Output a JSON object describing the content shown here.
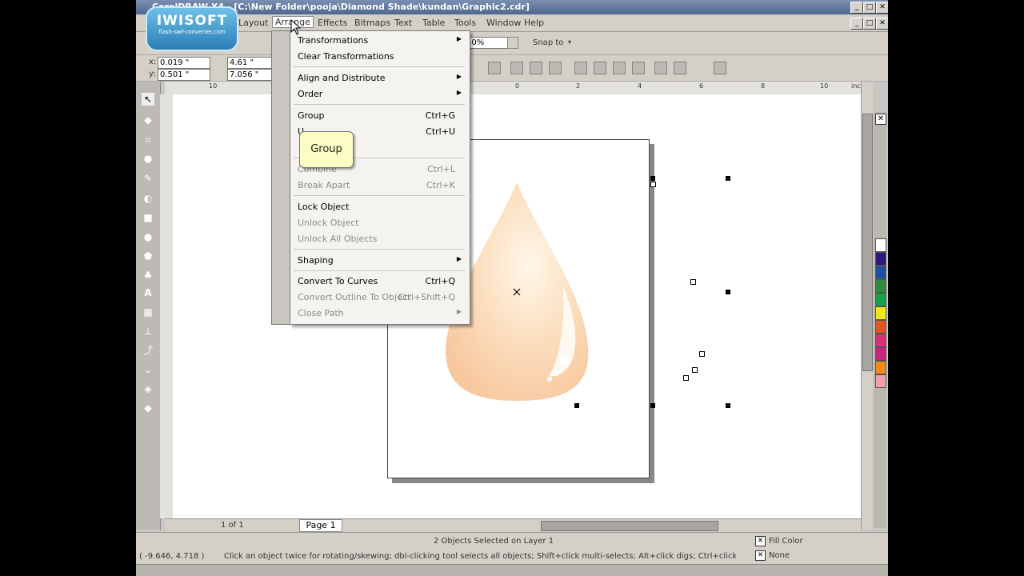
{
  "window": {
    "title": "CorelDRAW X4 - [C:\\New Folder\\pooja\\Diamond Shade\\kundan\\Graphic2.cdr]",
    "controls": [
      "_",
      "□",
      "✕"
    ]
  },
  "logo": {
    "brand": "IWISOFT",
    "tagline": "flash-swf-converter.com"
  },
  "menubar": {
    "items": [
      "Layout",
      "Arrange",
      "Effects",
      "Bitmaps",
      "Text",
      "Table",
      "Tools",
      "Window",
      "Help"
    ]
  },
  "stdbar": {
    "zoom": "40%",
    "snap_to": "Snap to"
  },
  "propbar": {
    "x": "0.019 \"",
    "y": "0.501 \"",
    "w": "4.61 \"",
    "h": "7.056 \""
  },
  "ruler": {
    "unit": "inches",
    "ticks": [
      "10",
      "0",
      "2",
      "4",
      "6",
      "8",
      "10"
    ]
  },
  "arrange_menu": {
    "items": [
      {
        "label": "Transformations",
        "shortcut": "",
        "submenu": true,
        "enabled": true
      },
      {
        "label": "Clear Transformations",
        "shortcut": "",
        "submenu": false,
        "enabled": true
      },
      {
        "label": "Align and Distribute",
        "shortcut": "",
        "submenu": true,
        "enabled": true
      },
      {
        "label": "Order",
        "shortcut": "",
        "submenu": true,
        "enabled": true
      },
      {
        "label": "Group",
        "shortcut": "Ctrl+G",
        "submenu": false,
        "enabled": true
      },
      {
        "label": "U",
        "shortcut": "Ctrl+U",
        "submenu": false,
        "enabled": true
      },
      {
        "label": "Combine",
        "shortcut": "Ctrl+L",
        "submenu": false,
        "enabled": false
      },
      {
        "label": "Break Apart",
        "shortcut": "Ctrl+K",
        "submenu": false,
        "enabled": false
      },
      {
        "label": "Lock Object",
        "shortcut": "",
        "submenu": false,
        "enabled": true
      },
      {
        "label": "Unlock Object",
        "shortcut": "",
        "submenu": false,
        "enabled": false
      },
      {
        "label": "Unlock All Objects",
        "shortcut": "",
        "submenu": false,
        "enabled": false
      },
      {
        "label": "Shaping",
        "shortcut": "",
        "submenu": true,
        "enabled": true
      },
      {
        "label": "Convert To Curves",
        "shortcut": "Ctrl+Q",
        "submenu": false,
        "enabled": true
      },
      {
        "label": "Convert Outline To Object",
        "shortcut": "Ctrl+Shift+Q",
        "submenu": false,
        "enabled": false
      },
      {
        "label": "Close Path",
        "shortcut": "",
        "submenu": true,
        "enabled": false
      }
    ]
  },
  "tooltip": {
    "text": "Group"
  },
  "pagebar": {
    "page_count": "1 of 1",
    "page_tab": "Page 1"
  },
  "status": {
    "selection": "2 Objects Selected on Layer 1",
    "coords": "( -9.646, 4.718 )",
    "hint": "Click an object twice for rotating/skewing; dbl-clicking tool selects all objects; Shift+click multi-selects; Alt+click digs; Ctrl+click selects in a group",
    "fill_label": "Fill Color",
    "outline_label": "None"
  },
  "colors": {
    "palette": [
      "#ffffff",
      "#2b1a7a",
      "#1f4fa0",
      "#2f8a3e",
      "#18a04a",
      "#f1e619",
      "#e6541f",
      "#d8307a",
      "#c7287e",
      "#f08a1c",
      "#f0a0a8"
    ],
    "drop_fill_light": "#fff7ea",
    "drop_fill_dark": "#f7c79d"
  }
}
